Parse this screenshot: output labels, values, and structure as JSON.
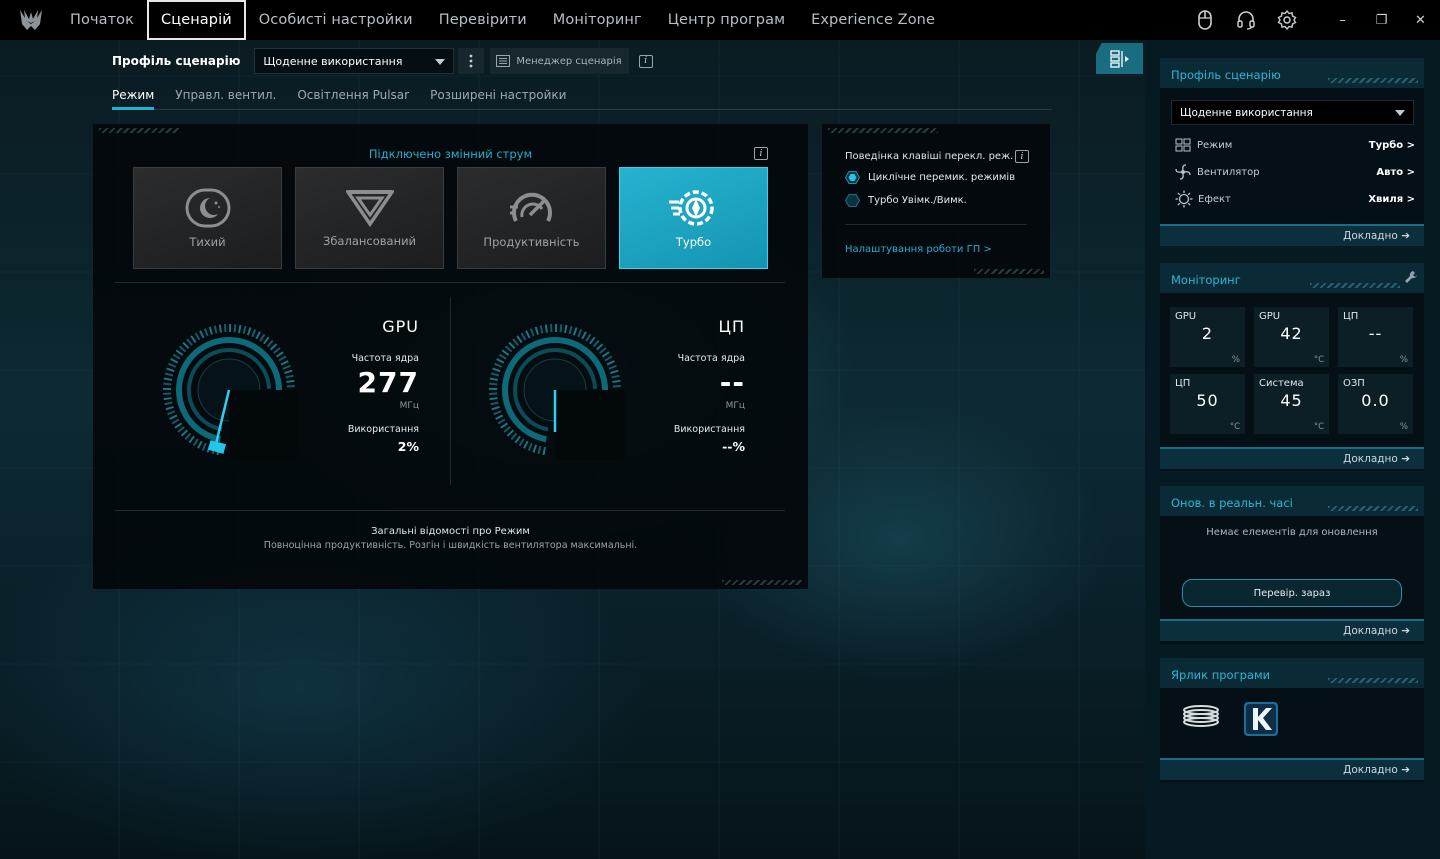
{
  "nav": {
    "items": [
      "Початок",
      "Сценарій",
      "Особисті настройки",
      "Перевірити",
      "Моніторинг",
      "Центр програм",
      "Experience Zone"
    ],
    "active_index": 1
  },
  "window": {
    "minimize": "–",
    "restore": "❐",
    "close": "✕"
  },
  "profile": {
    "label": "Профіль сценарію",
    "selected": "Щоденне використання",
    "manager_label": "Менеджер сценарія"
  },
  "tabs": [
    "Режим",
    "Управл. вентил.",
    "Освітлення Pulsar",
    "Розширені настройки"
  ],
  "mode_panel": {
    "power_status": "Підключено змінний струм",
    "modes": [
      {
        "label": "Тихий",
        "icon": "quiet-moon-icon"
      },
      {
        "label": "Збалансований",
        "icon": "balanced-chevron-icon"
      },
      {
        "label": "Продуктивність",
        "icon": "performance-gauge-icon"
      },
      {
        "label": "Турбо",
        "icon": "turbo-fan-icon"
      }
    ],
    "active_mode": "Турбо",
    "accent": "#1fb3d1"
  },
  "gpu": {
    "title": "GPU",
    "freq_label": "Частота ядра",
    "freq_value": "277",
    "freq_unit": "МГц",
    "usage_label": "Використання",
    "usage_value": "2%",
    "usage_fraction": 0.02
  },
  "cpu": {
    "title": "ЦП",
    "freq_label": "Частота ядра",
    "freq_value": "--",
    "freq_unit": "МГц",
    "usage_label": "Використання",
    "usage_value": "--%"
  },
  "summary": {
    "title": "Загальні відомості про Режим",
    "description": "Повноцінна продуктивність. Розгін і швидкість вентилятора максимальні."
  },
  "key_panel": {
    "title": "Поведінка клавіші перекл. реж.",
    "options": [
      "Циклічне перемик. режимів",
      "Турбо Увімк./Вимк."
    ],
    "selected_index": 0,
    "gpu_link": "Налаштування роботи ГП >"
  },
  "sidebar": {
    "profile_card": {
      "title": "Профіль сценарію",
      "selected": "Щоденне використання",
      "rows": [
        {
          "label": "Режим",
          "value": "Турбо >",
          "icon": "mode-grid-icon"
        },
        {
          "label": "Вентилятор",
          "value": "Авто >",
          "icon": "fan-icon"
        },
        {
          "label": "Ефект",
          "value": "Хвиля >",
          "icon": "effect-sun-icon"
        }
      ],
      "more": "Докладно"
    },
    "monitor_card": {
      "title": "Моніторинг",
      "tiles": [
        {
          "label": "GPU",
          "value": "2",
          "unit": "%"
        },
        {
          "label": "GPU",
          "value": "42",
          "unit": "°C"
        },
        {
          "label": "ЦП",
          "value": "--",
          "unit": "%"
        },
        {
          "label": "ЦП",
          "value": "50",
          "unit": "°C"
        },
        {
          "label": "Система",
          "value": "45",
          "unit": "°C"
        },
        {
          "label": "ОЗП",
          "value": "0.0",
          "unit": "%"
        }
      ],
      "more": "Докладно"
    },
    "update_card": {
      "title": "Онов. в реальн. часі",
      "empty": "Немає елементів для оновлення",
      "button": "Перевір. зараз",
      "more": "Докладно"
    },
    "shortcut_card": {
      "title": "Ярлик програми",
      "apps": [
        "coil-app-icon",
        "k-app-icon"
      ],
      "more": "Докладно"
    }
  }
}
